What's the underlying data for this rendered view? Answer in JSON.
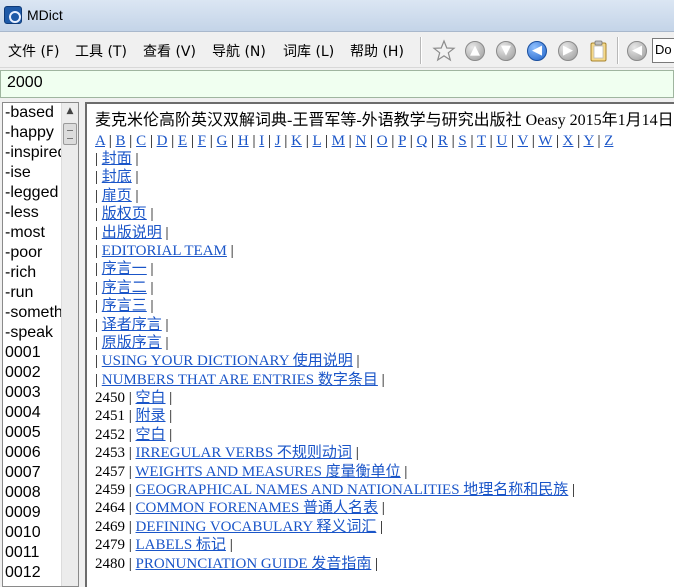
{
  "window": {
    "title": "MDict"
  },
  "menu": [
    {
      "label": "文件 (F)"
    },
    {
      "label": "工具 (T)"
    },
    {
      "label": "查看 (V)"
    },
    {
      "label": "导航 (N)"
    },
    {
      "label": "词库 (L)"
    },
    {
      "label": "帮助 (H)"
    }
  ],
  "toolbar": {
    "buttons": [
      {
        "icon": "star-icon"
      },
      {
        "icon": "arrow-up-icon"
      },
      {
        "icon": "arrow-down-icon"
      },
      {
        "icon": "arrow-left-icon"
      },
      {
        "icon": "arrow-right-icon"
      },
      {
        "icon": "clipboard-icon"
      },
      {
        "icon": "speaker-icon"
      }
    ],
    "lookup_value": "Do"
  },
  "search": {
    "value": "2000"
  },
  "wordlist": {
    "items": [
      "-based",
      "-happy",
      "-inspired",
      "-ise",
      "-legged",
      "-less",
      "-most",
      "-poor",
      "-rich",
      "-run",
      "-something",
      "-speak",
      "0001",
      "0002",
      "0003",
      "0004",
      "0005",
      "0006",
      "0007",
      "0008",
      "0009",
      "0010",
      "0011",
      "0012"
    ]
  },
  "entry": {
    "header": "麦克米伦高阶英汉双解词典-王晋军等-外语教学与研究出版社 Oeasy 2015年1月14日",
    "alphabet": [
      "A",
      "B",
      "C",
      "D",
      "E",
      "F",
      "G",
      "H",
      "I",
      "J",
      "K",
      "L",
      "M",
      "N",
      "O",
      "P",
      "Q",
      "R",
      "S",
      "T",
      "U",
      "V",
      "W",
      "X",
      "Y",
      "Z"
    ],
    "toc": [
      {
        "num": "",
        "label": "封面"
      },
      {
        "num": "",
        "label": "封底"
      },
      {
        "num": "",
        "label": "扉页"
      },
      {
        "num": "",
        "label": "版权页"
      },
      {
        "num": "",
        "label": "出版说明"
      },
      {
        "num": "",
        "label": "EDITORIAL TEAM"
      },
      {
        "num": "",
        "label": "序言一"
      },
      {
        "num": "",
        "label": "序言二"
      },
      {
        "num": "",
        "label": "序言三"
      },
      {
        "num": "",
        "label": "译者序言"
      },
      {
        "num": "",
        "label": "原版序言"
      },
      {
        "num": "",
        "label": "USING YOUR DICTIONARY 使用说明"
      },
      {
        "num": "",
        "label": "NUMBERS THAT ARE ENTRIES 数字条目"
      },
      {
        "num": "2450",
        "label": "空白"
      },
      {
        "num": "2451",
        "label": "附录"
      },
      {
        "num": "2452",
        "label": "空白"
      },
      {
        "num": "2453",
        "label": "IRREGULAR VERBS 不规则动词"
      },
      {
        "num": "2457",
        "label": "WEIGHTS AND MEASURES 度量衡单位"
      },
      {
        "num": "2459",
        "label": "GEOGRAPHICAL NAMES AND NATIONALITIES 地理名称和民族"
      },
      {
        "num": "2464",
        "label": "COMMON FORENAMES 普通人名表"
      },
      {
        "num": "2469",
        "label": "DEFINING VOCABULARY 释义词汇"
      },
      {
        "num": "2479",
        "label": "LABELS 标记"
      },
      {
        "num": "2480",
        "label": "PRONUNCIATION GUIDE 发音指南"
      }
    ]
  },
  "colors": {
    "link": "#1a55c8",
    "search_bg": "#f0fff0"
  }
}
